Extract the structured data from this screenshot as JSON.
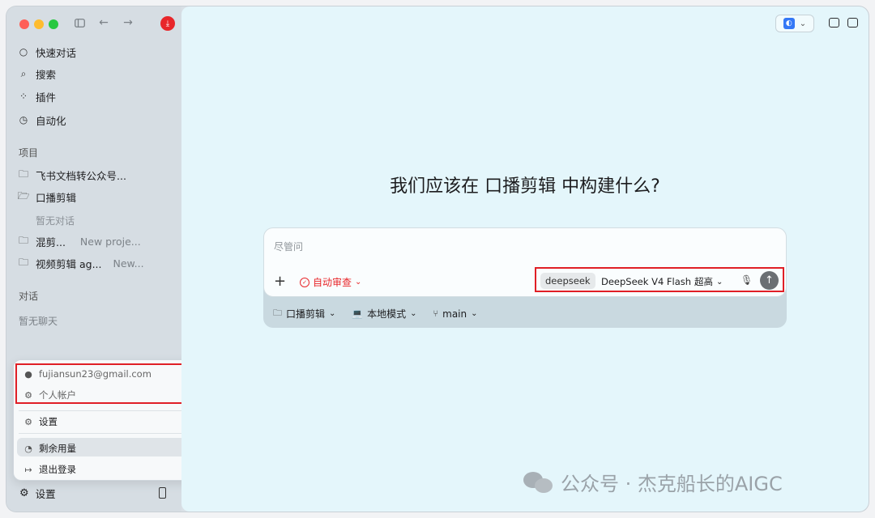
{
  "sidebar": {
    "nav": [
      {
        "label": "快速对话",
        "icon": "chat-bubble-icon"
      },
      {
        "label": "搜索",
        "icon": "search-icon"
      },
      {
        "label": "插件",
        "icon": "plugins-icon"
      },
      {
        "label": "自动化",
        "icon": "clock-icon"
      }
    ],
    "projects_label": "项目",
    "projects": [
      {
        "label": "飞书文档转公众号...",
        "sub": ""
      },
      {
        "label": "口播剪辑",
        "sub": ""
      },
      {
        "label": "混剪...",
        "sub": "New proje..."
      },
      {
        "label": "视频剪辑 ag...",
        "sub": "New..."
      }
    ],
    "empty_project_label": "暂无对话",
    "chats_label": "对话",
    "empty_chats_label": "暂无聊天",
    "bottom_settings": "设置"
  },
  "popup": {
    "email": "fujiansun23@gmail.com",
    "personal_account": "个人帐户",
    "settings": "设置",
    "remaining_usage": "剩余用量",
    "logout": "退出登录"
  },
  "main": {
    "heading": "我们应该在 口播剪辑 中构建什么?",
    "composer": {
      "placeholder": "尽管问",
      "plus": "+",
      "auto_review": "自动审查",
      "provider": "deepseek",
      "model": "DeepSeek V4 Flash",
      "effort": "超高"
    },
    "bottom_bar": {
      "project": "口播剪辑",
      "mode": "本地模式",
      "branch": "main"
    }
  },
  "watermark": "公众号 · 杰克船长的AIGC",
  "colors": {
    "accent_red": "#e8262a",
    "highlight_red": "#e01f26",
    "main_bg": "#e4f6fb",
    "sidebar_bg": "#d6dde3"
  }
}
